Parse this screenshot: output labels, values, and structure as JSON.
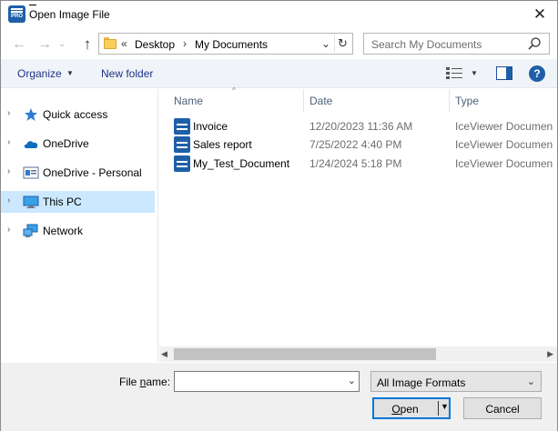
{
  "window": {
    "title": "Open Image File",
    "app_icon": "iceviewer-pro-icon",
    "app_icon_text": "PRO",
    "close_glyph": "✕"
  },
  "nav": {
    "back_glyph": "←",
    "forward_glyph": "→",
    "history_glyph": "⌄",
    "up_glyph": "↑"
  },
  "address": {
    "overflow_glyph": "«",
    "crumbs": [
      "Desktop",
      "My Documents"
    ],
    "separator_glyph": "›",
    "dropdown_glyph": "⌄",
    "refresh_glyph": "↻"
  },
  "search": {
    "placeholder": "Search My Documents"
  },
  "toolbar": {
    "organize_label": "Organize",
    "new_folder_label": "New folder",
    "help_label": "?"
  },
  "sidebar": {
    "items": [
      {
        "label": "Quick access",
        "icon": "star-icon"
      },
      {
        "label": "OneDrive",
        "icon": "cloud-icon"
      },
      {
        "label": "OneDrive - Personal",
        "icon": "onedrive-personal-icon"
      },
      {
        "label": "This PC",
        "icon": "computer-icon",
        "selected": true
      },
      {
        "label": "Network",
        "icon": "network-icon"
      }
    ]
  },
  "columns": {
    "name": "Name",
    "date": "Date",
    "type": "Type"
  },
  "files": [
    {
      "name": "Invoice",
      "date": "12/20/2023 11:36 AM",
      "type": "IceViewer Document"
    },
    {
      "name": "Sales report",
      "date": "7/25/2022 4:40 PM",
      "type": "IceViewer Document"
    },
    {
      "name": "My_Test_Document",
      "date": "1/24/2024 5:18 PM",
      "type": "IceViewer Document"
    }
  ],
  "bottom": {
    "file_name_label_pre": "File ",
    "file_name_label_u": "n",
    "file_name_label_post": "ame:",
    "file_name_value": "",
    "filter_value": "All Image Formats",
    "open_label_u": "O",
    "open_label_post": "pen",
    "cancel_label": "Cancel"
  },
  "colors": {
    "accent": "#0078d7",
    "selection": "#cce8ff",
    "link": "#1e3287",
    "icon_blue": "#1f5fa8"
  }
}
